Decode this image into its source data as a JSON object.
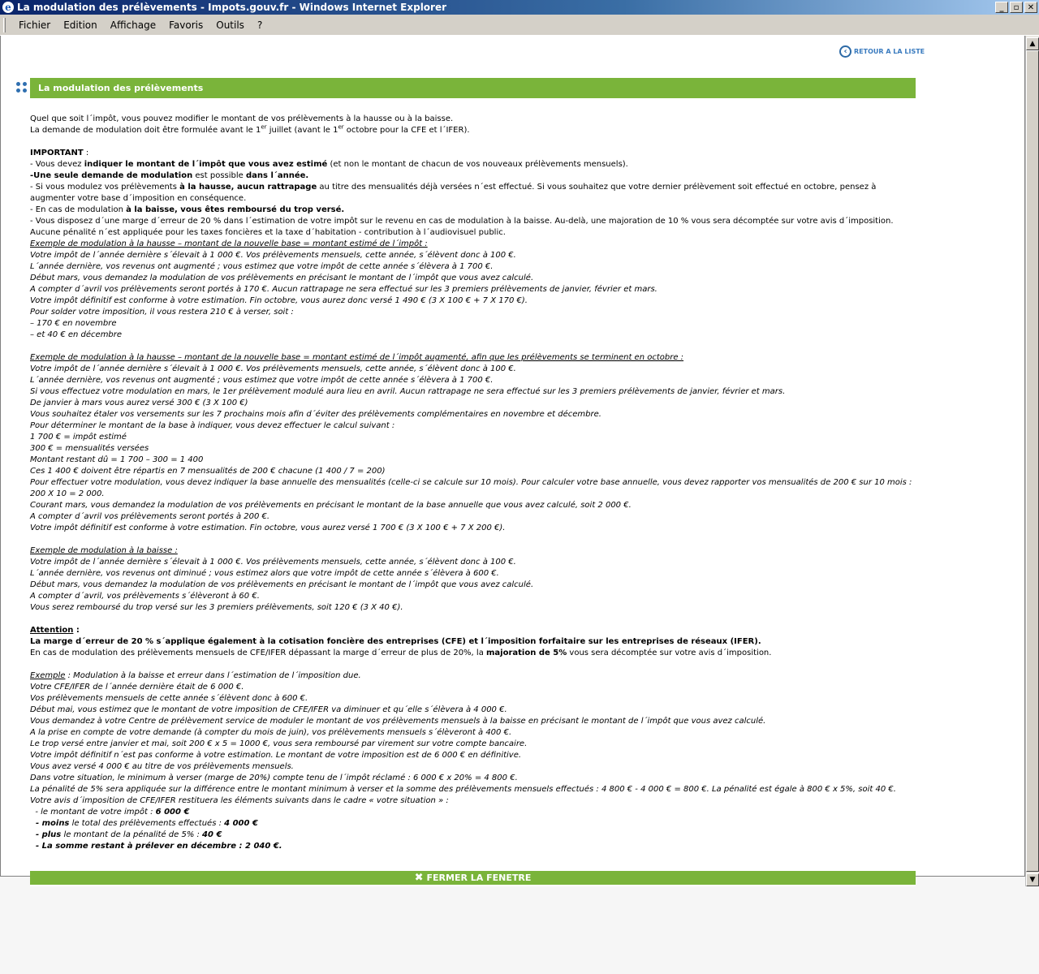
{
  "window": {
    "title": "La modulation des prélèvements - Impots.gouv.fr - Windows Internet Explorer",
    "icon": "ie-icon",
    "buttons": {
      "minimize": "_",
      "maximize": "▫",
      "close": "✕"
    }
  },
  "menu": [
    "Fichier",
    "Edition",
    "Affichage",
    "Favoris",
    "Outils",
    "?"
  ],
  "retour": "RETOUR A LA LISTE",
  "header": "La modulation des prélèvements",
  "intro": {
    "l1": "Quel que soit l´impôt, vous pouvez modifier le montant de vos prélèvements à la hausse ou à la baisse.",
    "l2a": "La demande de modulation doit être formulée avant le 1",
    "l2sup": "er",
    "l2b": " juillet (avant le 1",
    "l2sup2": "er",
    "l2c": " octobre pour la CFE et l´IFER)."
  },
  "important": {
    "title": "IMPORTANT",
    "title_suffix": " :",
    "p1a": "- Vous devez ",
    "p1b": "indiquer le montant de l´impôt que vous avez estimé",
    "p1c": " (et non le montant de chacun de vos nouveaux prélèvements mensuels).",
    "p2a": "-Une seule demande de modulation",
    "p2b": " est possible ",
    "p2c": "dans l´année.",
    "p3a": "- Si vous modulez vos prélèvements ",
    "p3b": "à la hausse, aucun rattrapage",
    "p3c": " au titre des mensualités déjà versées n´est effectué. Si vous souhaitez que votre dernier prélèvement soit effectué en octobre, pensez à augmenter votre base d´imposition en conséquence.",
    "p4a": "- En cas de modulation ",
    "p4b": "à la baisse, vous êtes remboursé du trop versé.",
    "p5": "- Vous disposez d´une marge d´erreur de 20 % dans l´estimation de votre impôt sur le revenu en cas de modulation à la baisse. Au-delà, une majoration de 10 % vous sera décomptée sur votre avis d´imposition.",
    "p6": "Aucune pénalité n´est appliquée pour les taxes foncières et la taxe d´habitation - contribution à l´audiovisuel public."
  },
  "ex1": {
    "title": "Exemple de modulation à la hausse – montant de la nouvelle base = montant estimé de l´impôt :",
    "lines": [
      "Votre impôt de l´année dernière s´élevait à 1 000 €. Vos prélèvements mensuels, cette année, s´élèvent donc à 100 €.",
      "L´année dernière, vos revenus ont augmenté ; vous estimez que votre impôt de cette année s´élèvera à 1 700 €.",
      "Début mars, vous demandez la modulation de vos prélèvements en précisant le montant de l´impôt que vous avez calculé.",
      "A compter d´avril vos prélèvements seront portés à 170 €. Aucun rattrapage ne sera effectué sur les 3 premiers prélèvements de janvier, février et mars.",
      "Votre impôt définitif est conforme à votre estimation. Fin octobre, vous aurez donc versé 1 490 € (3 X 100 € + 7 X 170 €).",
      "Pour solder votre imposition, il vous restera 210 € à verser, soit :",
      "– 170 € en novembre",
      "– et 40 € en décembre"
    ]
  },
  "ex2": {
    "title": "Exemple de modulation à la hausse – montant de la nouvelle base = montant estimé de l´impôt augmenté, afin que les prélèvements se terminent en octobre :",
    "lines": [
      "Votre impôt de l´année dernière s´élevait à 1 000 €. Vos prélèvements mensuels, cette année, s´élèvent donc à 100 €.",
      "L´année dernière, vos revenus ont augmenté ; vous estimez que votre impôt de cette année s´élèvera à 1 700 €.",
      "Si vous effectuez votre modulation en mars, le 1er prélèvement modulé aura lieu en avril. Aucun rattrapage ne sera effectué sur les 3 premiers prélèvements de janvier, février et mars.",
      "De janvier à mars vous aurez versé 300 € (3 X 100 €)",
      "Vous souhaitez étaler vos versements sur les 7 prochains mois afin d´éviter des prélèvements complémentaires en novembre et décembre.",
      "Pour déterminer le montant de la base à indiquer, vous devez effectuer le calcul suivant :",
      "1 700 € = impôt estimé",
      "300 € = mensualités versées",
      "Montant restant dû = 1 700 – 300 = 1 400",
      "Ces 1 400 € doivent être répartis en 7 mensualités de 200 € chacune (1 400 / 7 = 200)"
    ],
    "wrap_line": "Pour effectuer votre modulation, vous devez  indiquer la base annuelle des mensualités (celle-ci se calcule sur 10 mois). Pour calculer votre base annuelle, vous devez rapporter vos mensualités de 200 € sur 10 mois : 200 X 10 = 2 000.",
    "lines_after": [
      "Courant mars, vous demandez la modulation de vos prélèvements en précisant le montant de la base annuelle que vous avez calculé, soit 2 000 €.",
      "A compter d´avril vos prélèvements seront portés à 200 €.",
      "Votre impôt définitif est conforme à votre estimation. Fin octobre, vous aurez versé 1 700 € (3 X 100 € + 7 X 200 €)."
    ]
  },
  "ex3": {
    "title": "Exemple de modulation à la baisse :",
    "lines": [
      "Votre impôt de l´année dernière s´élevait à 1 000 €. Vos prélèvements mensuels, cette année, s´élèvent donc à 100 €.",
      "L´année dernière, vos revenus ont diminué ; vous estimez alors que votre impôt de cette année s´élèvera à 600 €.",
      "Début mars, vous demandez la modulation de vos prélèvements en précisant le montant de l´impôt que vous avez calculé.",
      "A compter d´avril, vos prélèvements s´élèveront à 60 €.",
      "Vous serez remboursé du trop versé sur les 3 premiers prélèvements, soit 120 € (3 X 40 €)."
    ]
  },
  "attention": {
    "title": "Attention",
    "title_suffix": " :",
    "bold_line": "La marge d´erreur de 20 % s´applique également à la cotisation foncière des entreprises (CFE) et l´imposition forfaitaire sur les entreprises de réseaux (IFER).",
    "l2a": "En cas de modulation des prélèvements mensuels de CFE/IFER dépassant la marge d´erreur de plus de 20%, la ",
    "l2b": "majoration de 5%",
    "l2c": " vous sera décomptée sur votre avis d´imposition."
  },
  "ex4": {
    "title": "Exemple",
    "title_rest": " : Modulation à la baisse et erreur dans l´estimation de l´imposition due.",
    "lines": [
      "Votre CFE/IFER de l´année dernière était de 6 000 €.",
      "Vos prélèvements mensuels de cette année s´élèvent donc à 600 €.",
      "Début mai, vous estimez que le montant de votre imposition de CFE/IFER va diminuer et qu´elle s´élèvera à 4 000 €.",
      "Vous demandez à votre Centre de prélèvement service de moduler le montant de vos prélèvements mensuels à la baisse en précisant le montant de l´impôt que vous avez calculé.",
      "A la prise en compte de votre demande (à compter du mois de juin), vos prélèvements mensuels s´élèveront à 400 €.",
      "Le trop versé entre janvier et mai, soit 200 € x 5 = 1000 €, vous sera remboursé par virement sur votre compte bancaire.",
      "Votre impôt définitif n´est pas conforme à votre estimation. Le montant de votre imposition est de 6 000 € en définitive.",
      "Vous avez versé 4 000 € au titre de vos prélèvements mensuels.",
      "Dans votre situation, le minimum à verser (marge de 20%) compte tenu de l´impôt réclamé : 6 000 € x 20% = 4 800 €.",
      "La pénalité de 5% sera appliquée sur la différence entre le montant minimum à verser et la somme des prélèvements mensuels effectués : 4 800 € - 4 000 € = 800 €. La pénalité est égale à 800 € x 5%, soit 40 €.",
      "Votre avis d´imposition de CFE/IFER restituera les éléments suivants dans le cadre « votre situation » :"
    ],
    "s1a": "  - le montant de votre impôt : ",
    "s1b": "6 000 €",
    "s2a": "  - moins",
    "s2b": " le total des prélèvements effectués : ",
    "s2c": "4 000 €",
    "s3a": "  - plus",
    "s3b": " le montant de la pénalité de 5% : ",
    "s3c": "40 €",
    "s4": "  - La somme restant à prélever en décembre : 2 040 €."
  },
  "fermer": "FERMER LA FENETRE",
  "scrollbar": {
    "up": "▲",
    "down": "▼"
  }
}
